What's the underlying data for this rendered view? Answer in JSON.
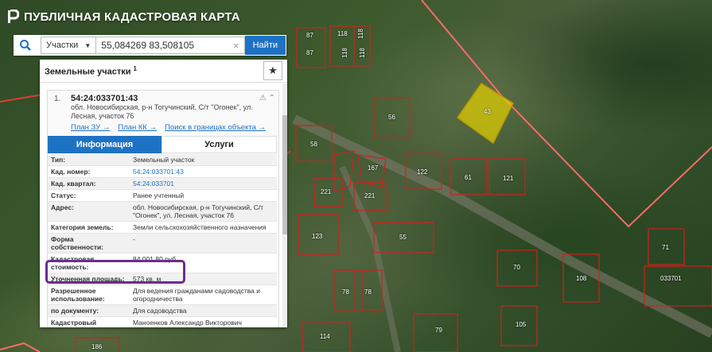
{
  "app": {
    "title": "ПУБЛИЧНАЯ КАДАСТРОВАЯ КАРТА"
  },
  "search": {
    "type_label": "Участки",
    "query": "55,084269 83,508105",
    "button_label": "Найти"
  },
  "panel": {
    "title": "Земельные участки",
    "title_count": "1"
  },
  "parcel": {
    "index": "1.",
    "cadastral_number": "54:24:033701:43",
    "address": "обл. Новосибирская, р-н Тогучинский, С/т \"Огонек\", ул. Лесная, участок 76",
    "links": [
      "План ЗУ →",
      "План КК →",
      "Поиск в границах объекта →"
    ],
    "tabs": {
      "info": "Информация",
      "services": "Услуги"
    },
    "rows": [
      {
        "k": "Тип:",
        "v": "Земельный участок"
      },
      {
        "k": "Кад. номер:",
        "v": "54:24:033701:43",
        "link": true
      },
      {
        "k": "Кад. квартал:",
        "v": "54:24:033701",
        "link": true
      },
      {
        "k": "Статус:",
        "v": "Ранее учтенный"
      },
      {
        "k": "Адрес:",
        "v": "обл. Новосибирская, р-н Тогучинский, С/т \"Огонек\", ул. Лесная, участок 76"
      },
      {
        "k": "Категория земель:",
        "v": "Земли сельскохозяйственного назначения"
      },
      {
        "k": "Форма собственности:",
        "v": "-"
      },
      {
        "k": "Кадастровая стоимость:",
        "v": "84 001,80 руб."
      },
      {
        "k": "Уточненная площадь:",
        "v": "573 кв. м"
      },
      {
        "k": "Разрешенное использование:",
        "v": "Для ведения гражданами садоводства и огородничества"
      },
      {
        "k": "по документу:",
        "v": "Для садоводства"
      },
      {
        "k": "Кадастровый инженер:",
        "v": "Маноенков Александр Викторович"
      }
    ]
  },
  "map": {
    "highlight_color": "#e6d200",
    "plot_labels": [
      "87",
      "118",
      "118",
      "87",
      "118",
      "118",
      "56",
      "43",
      "58",
      "167",
      "122",
      "61",
      "121",
      "221",
      "221",
      "123",
      "55",
      "71",
      "70",
      "108",
      "033701",
      "78",
      "78",
      "114",
      "79",
      "105",
      "186"
    ]
  }
}
